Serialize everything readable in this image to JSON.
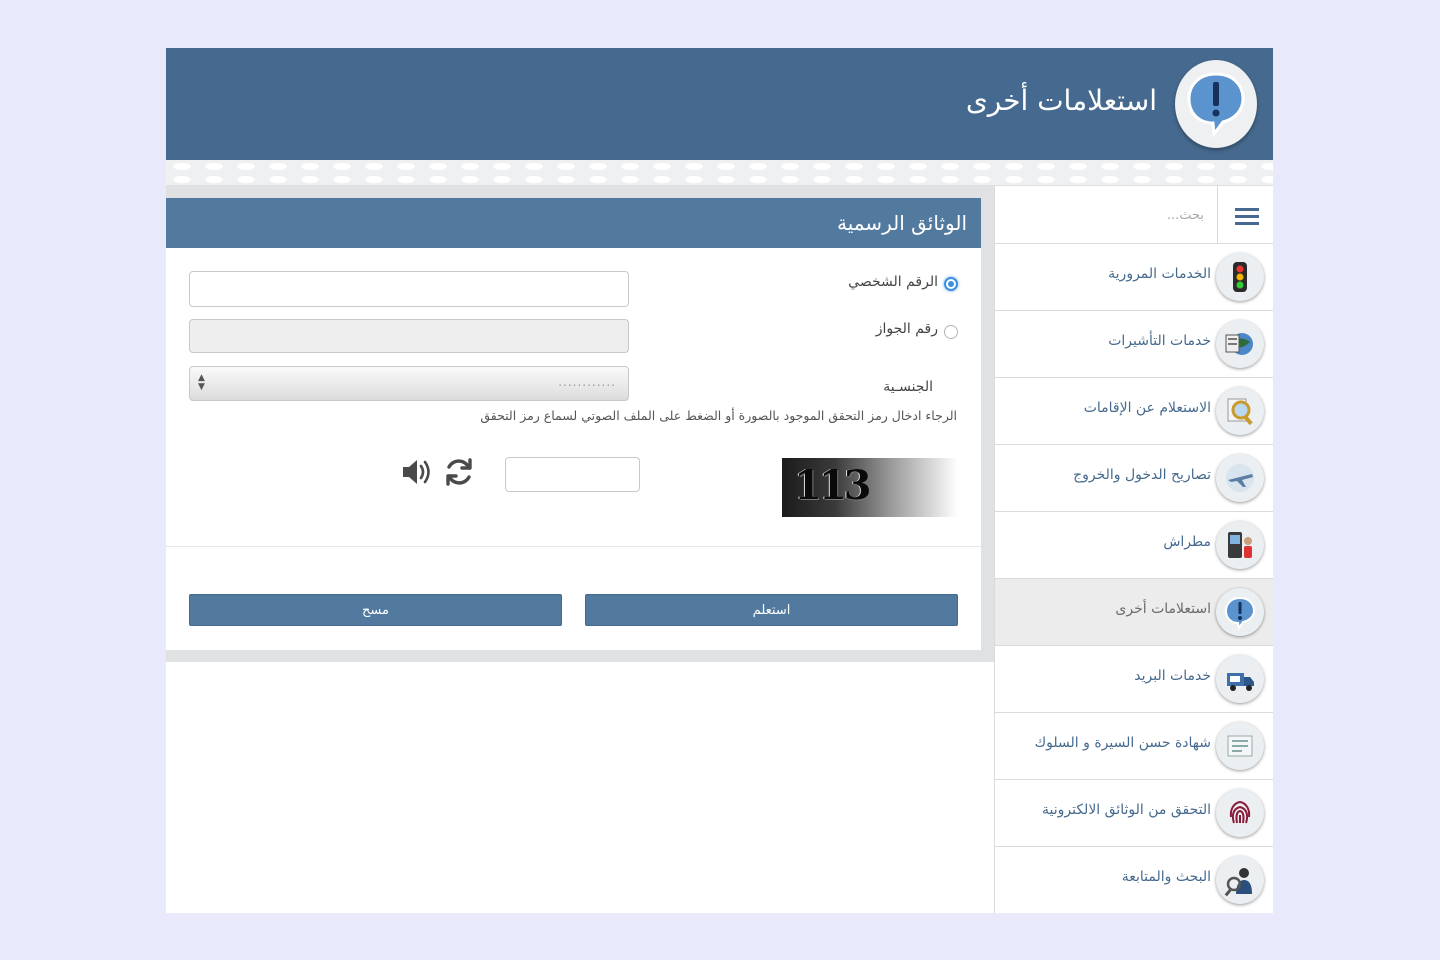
{
  "header": {
    "title": "استعلامات أخرى",
    "icon": "exclamation-bubble-icon"
  },
  "sidebar": {
    "search_placeholder": "بحث...",
    "items": [
      {
        "label": "الخدمات المرورية",
        "icon": "traffic-light-icon"
      },
      {
        "label": "خدمات التأشيرات",
        "icon": "visa-globe-icon"
      },
      {
        "label": "الاستعلام عن الإقامات",
        "icon": "magnifier-document-icon"
      },
      {
        "label": "تصاريح الدخول والخروج",
        "icon": "airplane-icon"
      },
      {
        "label": "مطراش",
        "icon": "kiosk-person-icon"
      },
      {
        "label": "استعلامات أخرى",
        "icon": "exclamation-bubble-icon",
        "active": true
      },
      {
        "label": "خدمات البريد",
        "icon": "mail-truck-icon"
      },
      {
        "label": "شهادة حسن السيرة و السلوك",
        "icon": "certificate-icon"
      },
      {
        "label": "التحقق من الوثائق الالكترونية",
        "icon": "fingerprint-icon"
      },
      {
        "label": "البحث والمتابعة",
        "icon": "search-person-icon"
      }
    ]
  },
  "form": {
    "title": "الوثائق الرسمية",
    "personal_id_label": "الرقم الشخصي",
    "personal_id_value": "",
    "passport_label": "رقم الجواز",
    "passport_value": "",
    "nationality_label": "الجنسـية",
    "nationality_value": "............",
    "instructions": "الرجاء ادخال رمز التحقق الموجود بالصورة أو الضغط على الملف الصوتي لسماع رمز التحقق",
    "captcha_text": "113",
    "captcha_value": "",
    "submit_label": "استعلم",
    "clear_label": "مسح"
  },
  "colors": {
    "header_bg": "#466a8f",
    "panel_head_bg": "#52799e",
    "link_text": "#466a8f",
    "page_bg": "#e8eafb"
  }
}
